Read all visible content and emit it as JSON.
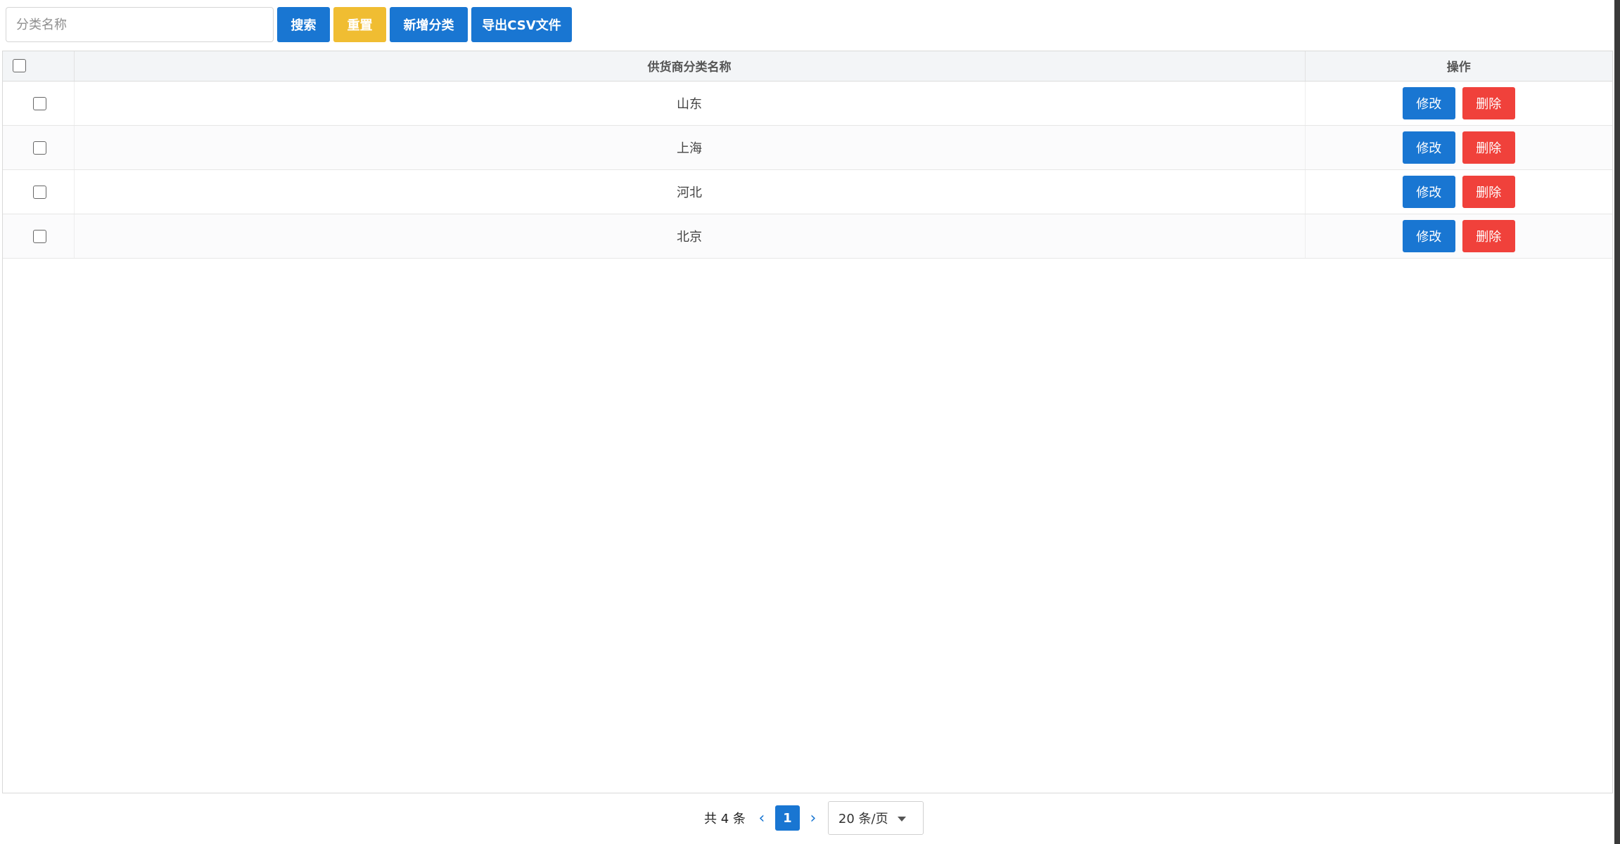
{
  "toolbar": {
    "search_placeholder": "分类名称",
    "search_value": "",
    "search_label": "搜索",
    "reset_label": "重置",
    "add_label": "新增分类",
    "export_label": "导出CSV文件"
  },
  "table": {
    "columns": [
      "",
      "供货商分类名称",
      "操作"
    ],
    "rows": [
      {
        "name": "山东",
        "edit": "修改",
        "delete": "删除"
      },
      {
        "name": "上海",
        "edit": "修改",
        "delete": "删除"
      },
      {
        "name": "河北",
        "edit": "修改",
        "delete": "删除"
      },
      {
        "name": "北京",
        "edit": "修改",
        "delete": "删除"
      }
    ]
  },
  "pagination": {
    "total_text": "共 4 条",
    "current_page": "1",
    "page_size": "20 条/页",
    "prev_icon": "chevron-left-icon",
    "next_icon": "chevron-right-icon"
  },
  "colors": {
    "primary": "#1976d2",
    "warning": "#f0bd32",
    "danger": "#f0413b"
  }
}
